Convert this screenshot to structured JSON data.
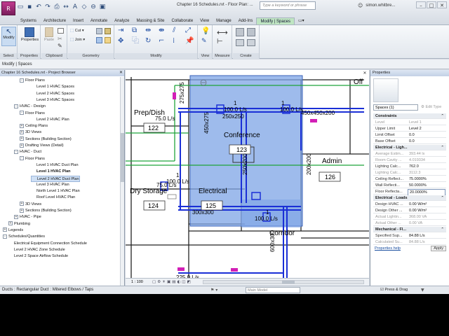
{
  "app": {
    "title": "Chapter 16 Schedules.rvt - Floor Plan: ...",
    "search_placeholder": "Type a keyword or phrase",
    "user": "simon.whitbre...",
    "window_buttons": [
      "–",
      "□",
      "✕"
    ]
  },
  "tabs": [
    "Systems",
    "Architecture",
    "Insert",
    "Annotate",
    "Analyze",
    "Massing & Site",
    "Collaborate",
    "View",
    "Manage",
    "Add-Ins",
    "Modify | Spaces"
  ],
  "ribbon": {
    "select": {
      "button": "Modify",
      "label": "Select"
    },
    "properties": {
      "button": "Properties",
      "label": "Properties"
    },
    "clipboard": {
      "paste": "Paste",
      "label": "Clipboard"
    },
    "geometry": {
      "cut": "Cut",
      "join": "Join",
      "label": "Geometry"
    },
    "modify": {
      "label": "Modify"
    },
    "view": {
      "label": "View"
    },
    "measure": {
      "label": "Measure"
    },
    "create": {
      "label": "Create"
    }
  },
  "options_bar": "Modify | Spaces",
  "browser": {
    "title": "Chapter 16 Schedules.rvt - Project Browser",
    "items": [
      {
        "text": "Floor Plans",
        "level": 3,
        "exp": "-"
      },
      {
        "text": "Level 1 HVAC Spaces",
        "level": 5,
        "exp": ""
      },
      {
        "text": "Level 2 HVAC Spaces",
        "level": 5,
        "exp": ""
      },
      {
        "text": "Level 3 HVAC Spaces",
        "level": 5,
        "exp": ""
      },
      {
        "text": "HVAC - Design",
        "level": 2,
        "exp": "-"
      },
      {
        "text": "Floor Plans",
        "level": 3,
        "exp": "-"
      },
      {
        "text": "Level 2 HVAC Plan",
        "level": 5,
        "exp": ""
      },
      {
        "text": "Ceiling Plans",
        "level": 3,
        "exp": "+"
      },
      {
        "text": "3D Views",
        "level": 3,
        "exp": "+"
      },
      {
        "text": "Sections (Building Section)",
        "level": 3,
        "exp": "+"
      },
      {
        "text": "Drafting Views (Detail)",
        "level": 3,
        "exp": "+"
      },
      {
        "text": "HVAC - Duct",
        "level": 2,
        "exp": "-"
      },
      {
        "text": "Floor Plans",
        "level": 3,
        "exp": "-"
      },
      {
        "text": "Level 1 HVAC Duct Plan",
        "level": 5,
        "exp": ""
      },
      {
        "text": "Level 1 HVAC Plan",
        "level": 5,
        "exp": "",
        "bold": true
      },
      {
        "text": "Level 2 HVAC Duct Plan",
        "level": 5,
        "exp": "",
        "hl": true
      },
      {
        "text": "Level 3 HVAC Plan",
        "level": 5,
        "exp": ""
      },
      {
        "text": "North Level 1 HVAC Plan",
        "level": 5,
        "exp": ""
      },
      {
        "text": "Roof Level HVAC Plan",
        "level": 5,
        "exp": ""
      },
      {
        "text": "3D Views",
        "level": 3,
        "exp": "+"
      },
      {
        "text": "Sections (Building Section)",
        "level": 3,
        "exp": "+"
      },
      {
        "text": "HVAC - Pipe",
        "level": 2,
        "exp": "+"
      },
      {
        "text": "Plumbing",
        "level": 1,
        "exp": "+"
      },
      {
        "text": "Legends",
        "level": 0,
        "exp": "+"
      },
      {
        "text": "Schedules/Quantities",
        "level": 0,
        "exp": "-"
      },
      {
        "text": "Electrical Equipment Connection Schedule",
        "level": 1,
        "exp": ""
      },
      {
        "text": "Level 2 HVAC Zone Schedule",
        "level": 1,
        "exp": ""
      },
      {
        "text": "Level 2 Space Airflow Schedule",
        "level": 1,
        "exp": ""
      }
    ]
  },
  "canvas": {
    "labels": [
      {
        "text": "Prep/Dish",
        "k": "room"
      },
      {
        "text": "122",
        "k": "tag"
      },
      {
        "text": "75.0 L/s",
        "k": "flow"
      },
      {
        "text": "Dry Storage",
        "k": "room"
      },
      {
        "text": "124",
        "k": "tag"
      },
      {
        "text": "75.0 L/s",
        "k": "flow"
      },
      {
        "text": "Electrical",
        "k": "room"
      },
      {
        "text": "125",
        "k": "tag"
      },
      {
        "text": "Conference",
        "k": "room"
      },
      {
        "text": "123",
        "k": "tag"
      },
      {
        "text": "Admin",
        "k": "room"
      },
      {
        "text": "126",
        "k": "tag"
      },
      {
        "text": "Corridor",
        "k": "room"
      },
      {
        "text": "Off",
        "k": "room"
      },
      {
        "text": "1",
        "k": "flow"
      },
      {
        "text": "100.0 L/s",
        "k": "flow"
      },
      {
        "text": "1",
        "k": "flow"
      },
      {
        "text": "100.0 L/s",
        "k": "flow"
      },
      {
        "text": "1",
        "k": "flow"
      },
      {
        "text": "100.0 L/s",
        "k": "flow"
      },
      {
        "text": "1",
        "k": "flow"
      },
      {
        "text": "100.0 L/s",
        "k": "flow"
      },
      {
        "text": "250x250",
        "k": "dim"
      },
      {
        "text": "450x275",
        "k": "dim"
      },
      {
        "text": "450x450x200",
        "k": "dim"
      },
      {
        "text": "275x275",
        "k": "dim"
      },
      {
        "text": "250x200",
        "k": "dim"
      },
      {
        "text": "200x200",
        "k": "dim"
      },
      {
        "text": "300x300",
        "k": "dim"
      },
      {
        "text": "600x300",
        "k": "dim"
      },
      {
        "text": "225.0 L/s",
        "k": "flow"
      }
    ],
    "view_scale": "1 : 100"
  },
  "properties": {
    "title": "Properties",
    "type_selector": "Spaces (1)",
    "edit_type": "Edit Type",
    "rows": [
      {
        "k": "Constraints",
        "v": "",
        "group": true
      },
      {
        "k": "Level",
        "v": "Level 1",
        "grey": true
      },
      {
        "k": "Upper Limit",
        "v": "Level 2"
      },
      {
        "k": "Limit Offset",
        "v": "0.0"
      },
      {
        "k": "Base Offset",
        "v": "0.0"
      },
      {
        "k": "Electrical - Ligh...",
        "v": "",
        "group": true
      },
      {
        "k": "Average Estim...",
        "v": "393.44 lx",
        "grey": true
      },
      {
        "k": "Room Cavity ...",
        "v": "4.019334",
        "grey": true
      },
      {
        "k": "Lighting Calc...",
        "v": "762.0"
      },
      {
        "k": "Lighting Calc...",
        "v": "3112.3",
        "grey": true
      },
      {
        "k": "Ceiling Reflect...",
        "v": "75.0000%"
      },
      {
        "k": "Wall Reflecti...",
        "v": "50.0000%"
      },
      {
        "k": "Floor Reflecta...",
        "v": "20.0000%",
        "edit": true
      },
      {
        "k": "Electrical - Loads",
        "v": "",
        "group": true
      },
      {
        "k": "Design HVAC ...",
        "v": "0.00 W/m²"
      },
      {
        "k": "Design Other ...",
        "v": "0.00 W/m²"
      },
      {
        "k": "Actual Lightin...",
        "v": "368.00 VA",
        "grey": true
      },
      {
        "k": "Actual Other ...",
        "v": "0.00 VA",
        "grey": true
      },
      {
        "k": "Mechanical - Fl...",
        "v": "",
        "group": true
      },
      {
        "k": "Specified Sup...",
        "v": "84.88 L/s"
      },
      {
        "k": "Calculated Su...",
        "v": "84.88 L/s",
        "grey": true
      }
    ],
    "help": "Properties help",
    "apply": "Apply"
  },
  "status": {
    "text": "Ducts : Rectangular Duct : Mitered Elbows / Taps",
    "model": "Main Model",
    "press_drag": "Press & Drag"
  },
  "colors": {
    "selection": "#7da4e6",
    "duct": "#1a2fd6",
    "green": "#1fa33a",
    "magenta": "#d21fb6"
  }
}
